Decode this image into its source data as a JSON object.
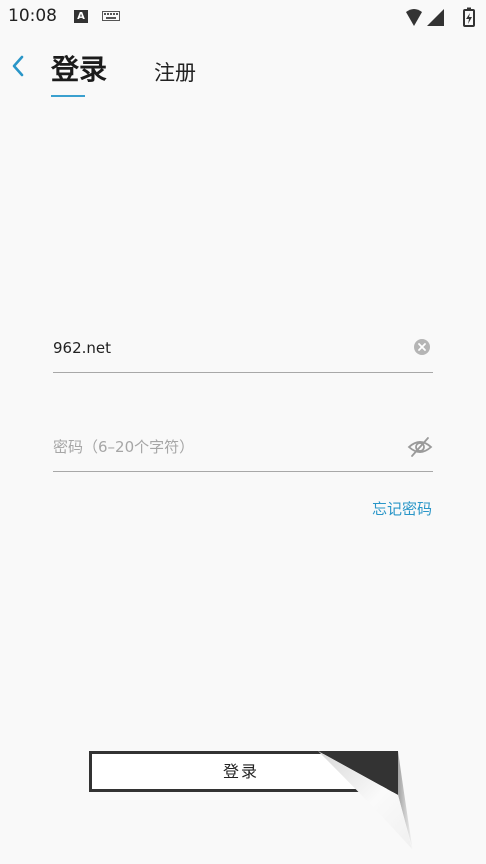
{
  "status_bar": {
    "time": "10:08",
    "notification_icon": "A",
    "icons": [
      "keyboard-icon",
      "wifi-icon",
      "signal-icon",
      "battery-icon"
    ]
  },
  "header": {
    "back_icon": "chevron-left-icon",
    "tabs": [
      {
        "label": "登录",
        "active": true
      },
      {
        "label": "注册",
        "active": false
      }
    ]
  },
  "form": {
    "username": {
      "value": "962.net"
    },
    "password": {
      "placeholder": "密码（6–20个字符）"
    },
    "forgot_password": "忘记密码"
  },
  "actions": {
    "login_label": "登录"
  },
  "colors": {
    "accent": "#2a96c8",
    "underline": "#3aa0cf",
    "background": "#f9f9f9"
  }
}
